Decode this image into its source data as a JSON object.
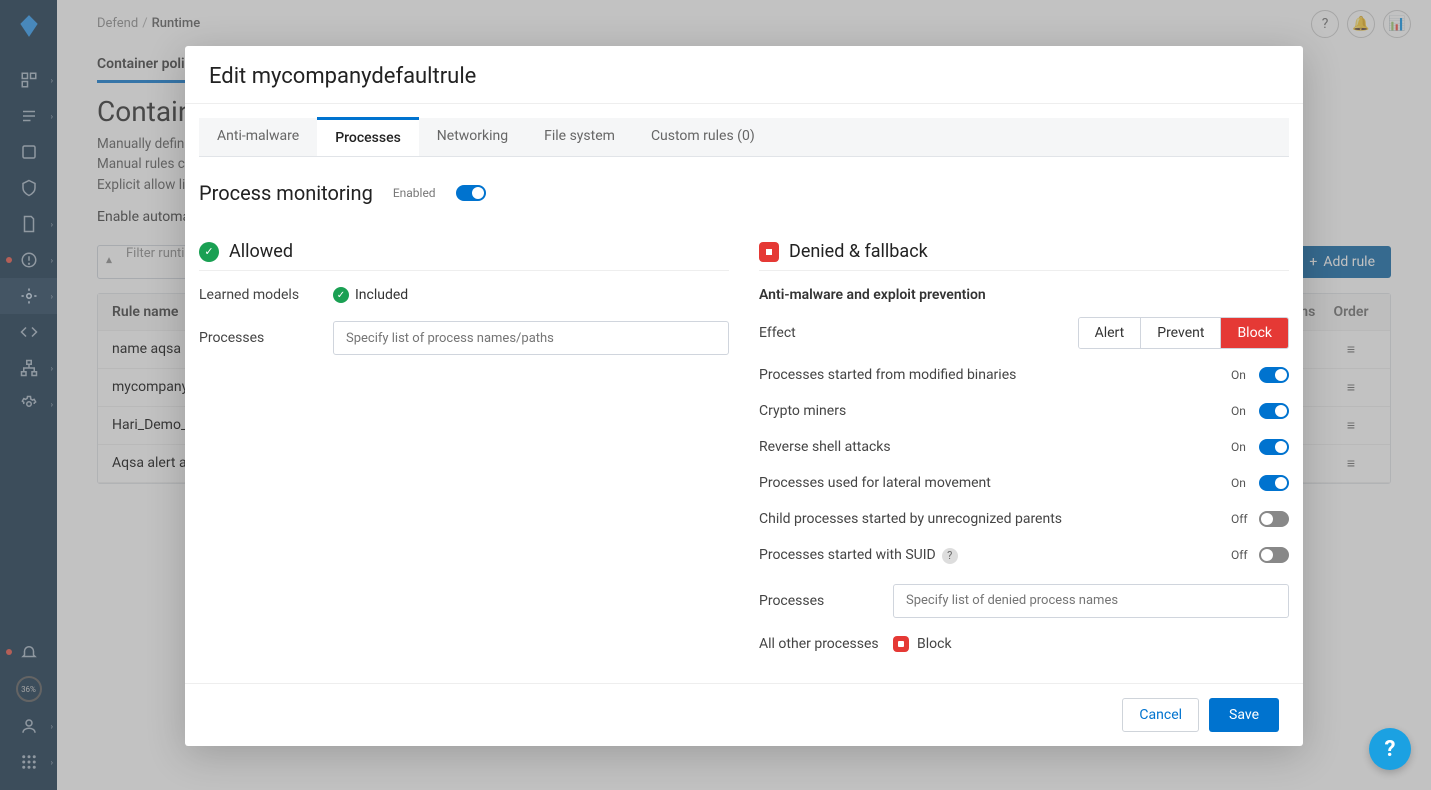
{
  "sidebar": {
    "gauge": "36%"
  },
  "breadcrumb": {
    "section": "Defend",
    "page": "Runtime"
  },
  "main_tab": "Container polic",
  "page_title": "Container r",
  "desc_lines": [
    "Manually defined r",
    "Manual rules can b",
    "Explicit allow lists i"
  ],
  "auto_label": "Enable automatic r",
  "filter_placeholder": "Filter runtime",
  "add_rule": "Add rule",
  "table": {
    "header": {
      "name": "Rule name",
      "actions": "ctions",
      "order": "Order"
    },
    "rows": [
      {
        "name": "name aqsa"
      },
      {
        "name": "mycompanydefau"
      },
      {
        "name": "Hari_Demo_Runt"
      },
      {
        "name": "Aqsa alert all"
      }
    ]
  },
  "modal": {
    "title": "Edit mycompanydefaultrule",
    "tabs": {
      "antimalware": "Anti-malware",
      "processes": "Processes",
      "networking": "Networking",
      "filesystem": "File system",
      "custom": "Custom rules (0)"
    },
    "pm_title": "Process monitoring",
    "enabled_label": "Enabled",
    "allowed_title": "Allowed",
    "learned_models": "Learned models",
    "included": "Included",
    "processes_label": "Processes",
    "processes_placeholder": "Specify list of process names/paths",
    "denied_title": "Denied & fallback",
    "denied_sub": "Anti-malware and exploit prevention",
    "effect_label": "Effect",
    "effects": {
      "alert": "Alert",
      "prevent": "Prevent",
      "block": "Block"
    },
    "toggles": [
      {
        "label": "Processes started from modified binaries",
        "state": "On",
        "on": true
      },
      {
        "label": "Crypto miners",
        "state": "On",
        "on": true
      },
      {
        "label": "Reverse shell attacks",
        "state": "On",
        "on": true
      },
      {
        "label": "Processes used for lateral movement",
        "state": "On",
        "on": true
      },
      {
        "label": "Child processes started by unrecognized parents",
        "state": "Off",
        "on": false
      },
      {
        "label": "Processes started with SUID",
        "state": "Off",
        "on": false,
        "help": true
      }
    ],
    "denied_processes_label": "Processes",
    "denied_processes_placeholder": "Specify list of denied process names",
    "other_label": "All other processes",
    "other_value": "Block",
    "cancel": "Cancel",
    "save": "Save"
  }
}
